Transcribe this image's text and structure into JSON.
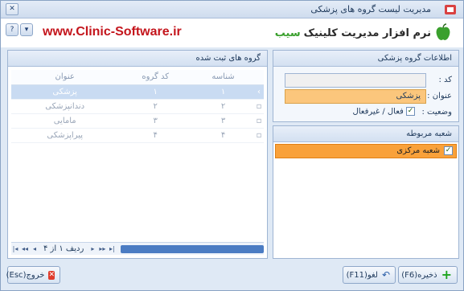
{
  "window": {
    "title": "مدیریت لیست گروه های پزشکی"
  },
  "header": {
    "url": "www.Clinic-Software.ir",
    "logo_text": "نرم افزار مدیریت کلینیک",
    "logo_brand": "سیب",
    "brand_color": "#3aa02d",
    "url_color": "#c4151c"
  },
  "info": {
    "title": "اطلاعات گروه پزشکی",
    "code_label": "کد :",
    "code_value": "",
    "name_label": "عنوان :",
    "name_value": "پزشکی",
    "status_label": "وضعیت :",
    "status_text": "فعال / غیرفعال",
    "status_checked": true
  },
  "branch": {
    "title": "شعبه مربوطه",
    "items": [
      {
        "label": "شعبه مرکزی",
        "checked": true
      }
    ]
  },
  "grid": {
    "title": "گروه های ثبت شده",
    "columns": [
      "شناسه",
      "کد گروه",
      "عنوان"
    ],
    "rows": [
      {
        "id": "۱",
        "code": "۱",
        "name": "پزشکی"
      },
      {
        "id": "۲",
        "code": "۲",
        "name": "دندانپزشکی"
      },
      {
        "id": "۳",
        "code": "۳",
        "name": "مامایی"
      },
      {
        "id": "۴",
        "code": "۴",
        "name": "پیراپزشکی"
      }
    ],
    "nav_text": "ردیف ۱ از ۴"
  },
  "buttons": {
    "save": "ذخیره(F6)",
    "undo": "لغو(F11)",
    "exit": "خروج(Esc)"
  }
}
